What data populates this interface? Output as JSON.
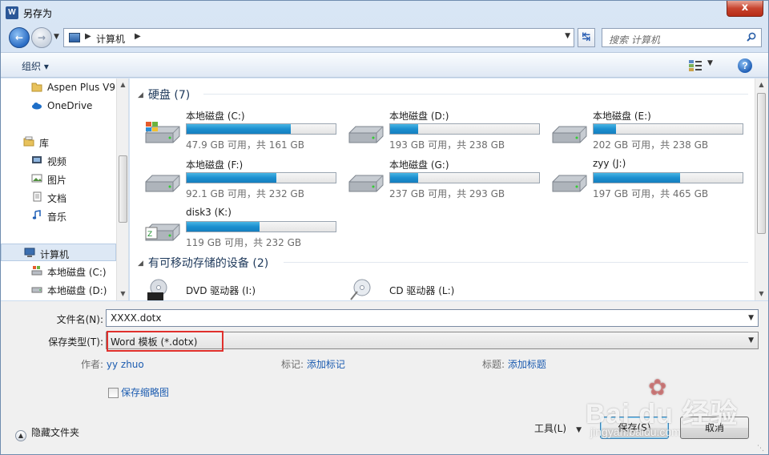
{
  "window": {
    "title": "另存为",
    "app_icon": "W",
    "close_glyph": "x"
  },
  "nav": {
    "address_path": "计算机",
    "search_placeholder": "搜索 计算机"
  },
  "toolbar": {
    "organize_label": "组织 ▾",
    "help_label": "?"
  },
  "sidebar": {
    "items": [
      {
        "label": "Aspen Plus V9",
        "icon": "folder-icon"
      },
      {
        "label": "OneDrive",
        "icon": "cloud-icon"
      },
      {
        "label": "库",
        "icon": "library-icon"
      },
      {
        "label": "视频",
        "icon": "video-icon"
      },
      {
        "label": "图片",
        "icon": "picture-icon"
      },
      {
        "label": "文档",
        "icon": "document-icon"
      },
      {
        "label": "音乐",
        "icon": "music-icon"
      },
      {
        "label": "计算机",
        "icon": "computer-icon"
      },
      {
        "label": "本地磁盘 (C:)",
        "icon": "system-drive-icon"
      },
      {
        "label": "本地磁盘 (D:)",
        "icon": "drive-icon"
      }
    ]
  },
  "content": {
    "groups": [
      {
        "label": "硬盘 (7)"
      },
      {
        "label": "有可移动存储的设备 (2)"
      }
    ],
    "drives": [
      {
        "name": "本地磁盘 (C:)",
        "free": "47.9 GB 可用，共 161 GB",
        "used_fraction": 0.7,
        "system": true
      },
      {
        "name": "本地磁盘 (D:)",
        "free": "193 GB 可用，共 238 GB",
        "used_fraction": 0.19,
        "system": false
      },
      {
        "name": "本地磁盘 (E:)",
        "free": "202 GB 可用，共 238 GB",
        "used_fraction": 0.15,
        "system": false
      },
      {
        "name": "本地磁盘 (F:)",
        "free": "92.1 GB 可用，共 232 GB",
        "used_fraction": 0.6,
        "system": false
      },
      {
        "name": "本地磁盘 (G:)",
        "free": "237 GB 可用，共 293 GB",
        "used_fraction": 0.19,
        "system": false
      },
      {
        "name": "zyy (J:)",
        "free": "197 GB 可用，共 465 GB",
        "used_fraction": 0.58,
        "system": false
      },
      {
        "name": "disk3 (K:)",
        "free": "119 GB 可用，共 232 GB",
        "used_fraction": 0.49,
        "system": false
      }
    ],
    "optical": [
      {
        "name": "DVD 驱动器 (I:)",
        "icon": "dvd-drive-icon"
      },
      {
        "name": "CD 驱动器 (L:)",
        "icon": "cd-drive-icon"
      }
    ]
  },
  "form": {
    "filename_label": "文件名(N):",
    "filename_value": "XXXX.dotx",
    "filetype_label": "保存类型(T):",
    "filetype_value": "Word 模板 (*.dotx)",
    "author_label": "作者:",
    "author_value": "yy zhuo",
    "tags_label": "标记:",
    "tags_value": "添加标记",
    "subject_label": "标题:",
    "subject_value": "添加标题",
    "thumbnail_label": "保存缩略图"
  },
  "footer": {
    "hide_folders_label": "隐藏文件夹",
    "tools_label": "工具(L)",
    "save_label": "保存(S)",
    "cancel_label": "取消"
  },
  "watermark": {
    "main": "Bai du 经验",
    "sub": "jingyan.baidu.com"
  },
  "colors": {
    "accent": "#1c5cb0",
    "highlight": "#e0302c",
    "bar_fill": "#1c8fcf"
  }
}
